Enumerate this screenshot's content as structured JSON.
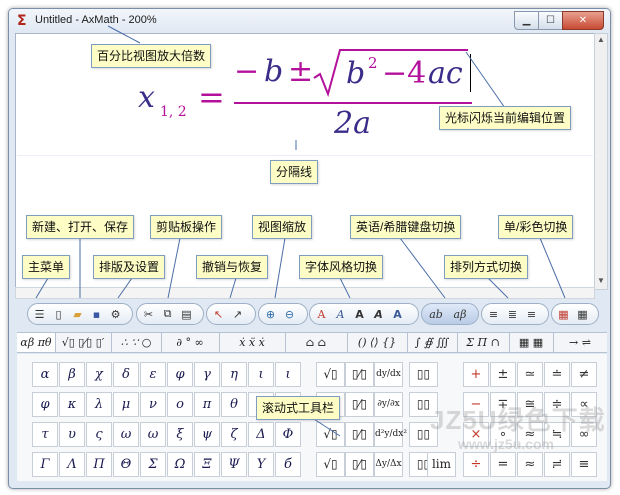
{
  "window": {
    "title": "Untitled - AxMath - 200%",
    "app_icon": "Σ"
  },
  "equation": {
    "x": "x",
    "subscript": "1, 2",
    "equals": "=",
    "numerator_minus": "−",
    "b": "b",
    "pm": "±",
    "root_b": "b",
    "exponent": "2",
    "minus4": "−4",
    "ac": "ac",
    "denominator": "2a"
  },
  "callouts": {
    "zoom_view": "百分比视图放大倍数",
    "cursor_pos": "光标闪烁当前编辑位置",
    "separator": "分隔线",
    "new_open_save": "新建、打开、保存",
    "clipboard": "剪贴板操作",
    "view_zoom": "视图缩放",
    "en_greek": "英语/希腊键盘切换",
    "mono_color": "单/彩色切换",
    "main_menu": "主菜单",
    "layout_settings": "排版及设置",
    "undo_redo": "撤销与恢复",
    "font_style": "字体风格切换",
    "align": "排列方式切换",
    "scroll_toolbar": "滚动式工具栏"
  },
  "toolbar": {
    "style_buttons": [
      "A",
      "A",
      "A",
      "A",
      "A"
    ],
    "kbd_buttons": [
      "ab",
      "aβ"
    ]
  },
  "tabs": [
    "αβ πθ",
    "√▯ ▯⁄▯ ▯′",
    "∴ ∵ ○",
    "∂ ° ∞",
    "ẋ ẍ ẋ",
    "⌂ ⌂",
    "() ⟨⟩ {}",
    "∫ ∯ ∭",
    "Σ Π ∩",
    "▦ ▦",
    "→ ⇌"
  ],
  "greek_rows": [
    [
      "α",
      "β",
      "χ",
      "δ",
      "ε",
      "φ",
      "γ",
      "η",
      "ι"
    ],
    [
      "φ",
      "κ",
      "λ",
      "μ",
      "ν",
      "ο",
      "π",
      "θ",
      "ρ"
    ],
    [
      "τ",
      "υ",
      "ς",
      "ω",
      "ω",
      "ξ",
      "ψ",
      "ζ",
      "Δ"
    ],
    [
      "Γ",
      "Λ",
      "Π",
      "Θ",
      "Σ",
      "Ω",
      "Ξ",
      "Ψ",
      "Υ"
    ]
  ],
  "greek_extra": [
    "ι",
    "σ",
    "Φ",
    "б"
  ],
  "struct_cells": [
    "√▯",
    "▯⁄▯",
    "dy/dx",
    "▯▯",
    "∂y/∂x",
    "d²y/dx²",
    "Δy/Δx",
    "lim"
  ],
  "ops_rows": [
    [
      "+",
      "±",
      "≃",
      "≐",
      "≠"
    ],
    [
      "−",
      "∓",
      "≅",
      "≑",
      "∝"
    ],
    [
      "×",
      "∘",
      "≈",
      "≒",
      "∞"
    ],
    [
      "÷",
      "=",
      "≈",
      "≓",
      "≡"
    ]
  ],
  "watermark": {
    "line1": "JZ5U绿色下载",
    "line2": "www.jz5u.com"
  }
}
